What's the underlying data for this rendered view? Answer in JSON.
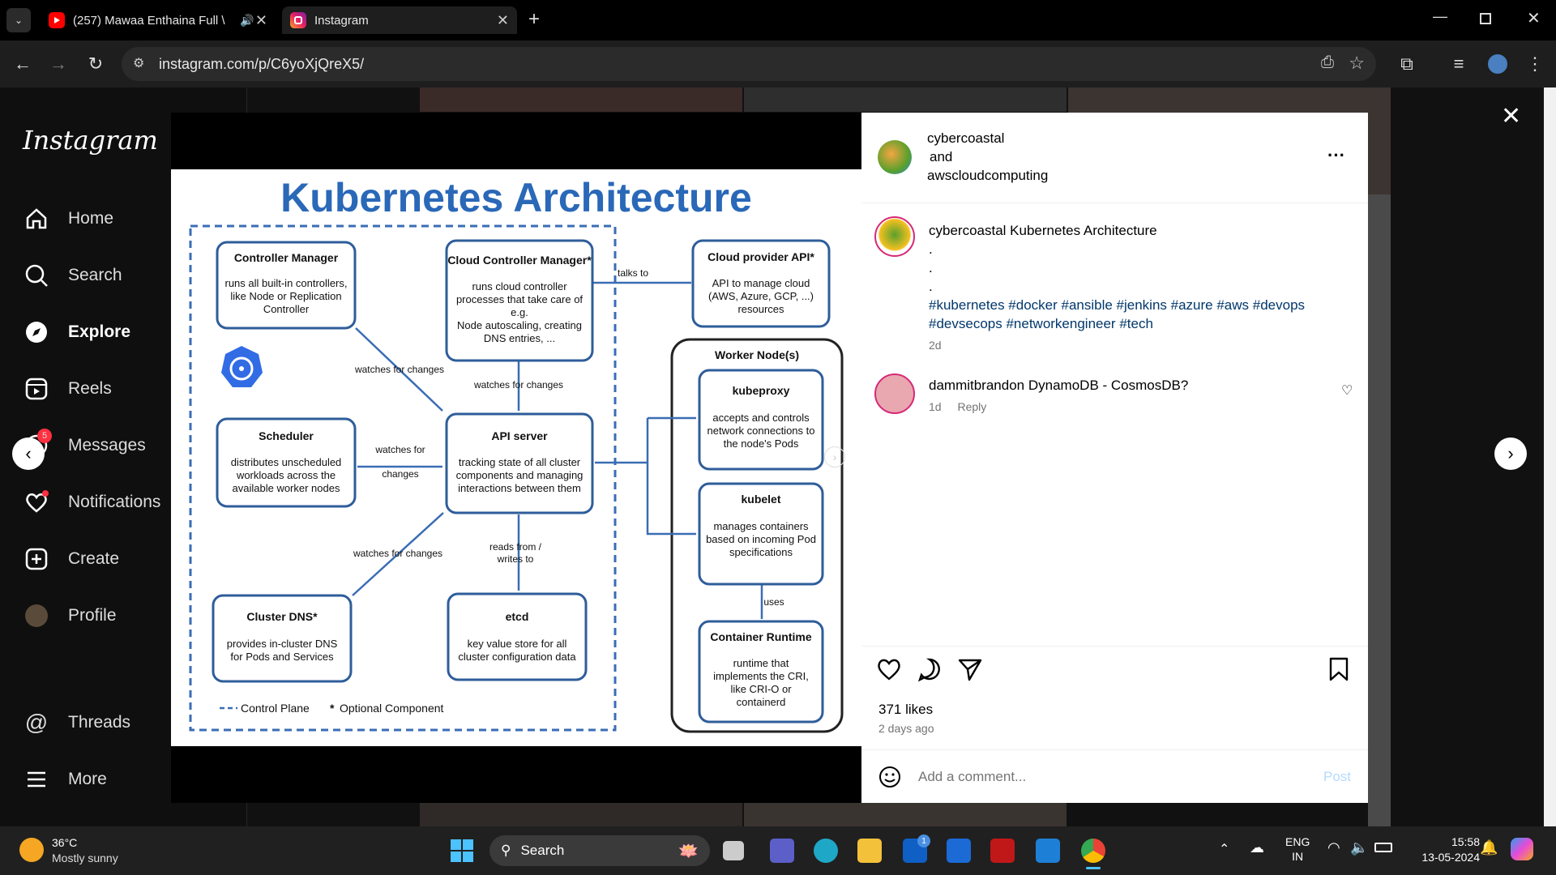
{
  "browser": {
    "tabs": [
      {
        "label": "(257) Mawaa Enthaina Full \\"
      },
      {
        "label": "Instagram"
      }
    ],
    "url": "instagram.com/p/C6yoXjQreX5/"
  },
  "sidebar": {
    "logo": "Instagram",
    "items": [
      {
        "label": "Home",
        "icon": "home-icon"
      },
      {
        "label": "Search",
        "icon": "search-icon"
      },
      {
        "label": "Explore",
        "icon": "compass-icon"
      },
      {
        "label": "Reels",
        "icon": "reels-icon"
      },
      {
        "label": "Messages",
        "icon": "messenger-icon",
        "badge": "5"
      },
      {
        "label": "Notifications",
        "icon": "heart-icon"
      },
      {
        "label": "Create",
        "icon": "plus-square-icon"
      },
      {
        "label": "Profile",
        "icon": "avatar-icon"
      },
      {
        "label": "Threads",
        "icon": "threads-icon"
      },
      {
        "label": "More",
        "icon": "menu-icon"
      }
    ]
  },
  "diagram": {
    "title": "Kubernetes Architecture",
    "controller_manager": {
      "title": "Controller Manager",
      "l1": "runs all built-in controllers,",
      "l2": "like Node or Replication",
      "l3": "Controller"
    },
    "cloud_controller": {
      "title": "Cloud Controller Manager*",
      "l1": "runs cloud controller",
      "l2": "processes that take care of",
      "l3": "e.g.",
      "l4": "Node autoscaling, creating",
      "l5": "DNS entries, ..."
    },
    "cloud_api": {
      "title": "Cloud provider API*",
      "l1": "API to manage cloud",
      "l2": "(AWS, Azure, GCP, ...)",
      "l3": "resources"
    },
    "scheduler": {
      "title": "Scheduler",
      "l1": "distributes unscheduled",
      "l2": "workloads across the",
      "l3": "available worker nodes"
    },
    "api_server": {
      "title": "API server",
      "l1": "tracking state of all cluster",
      "l2": "components and managing",
      "l3": "interactions between them"
    },
    "cluster_dns": {
      "title": "Cluster DNS*",
      "l1": "provides in-cluster DNS",
      "l2": "for Pods and Services"
    },
    "etcd": {
      "title": "etcd",
      "l1": "key value store for all",
      "l2": "cluster configuration data"
    },
    "worker": {
      "title": "Worker Node(s)"
    },
    "kubeproxy": {
      "title": "kubeproxy",
      "l1": "accepts and controls",
      "l2": "network connections to",
      "l3": "the node's Pods"
    },
    "kubelet": {
      "title": "kubelet",
      "l1": "manages containers",
      "l2": "based on incoming Pod",
      "l3": "specifications"
    },
    "runtime": {
      "title": "Container Runtime",
      "l1": "runtime that",
      "l2": "implements the CRI,",
      "l3": "like CRI-O or",
      "l4": "containerd"
    },
    "labels": {
      "talks_to": "talks to",
      "watches1": "watches for changes",
      "watches2": "watches for changes",
      "watches_for": "watches for",
      "changes": "changes",
      "watches3": "watches for changes",
      "reads": "reads from /",
      "writes": "writes to",
      "uses": "uses"
    },
    "legend": {
      "control_plane": "Control Plane",
      "optional": "Optional Component"
    }
  },
  "post": {
    "header_user": "cybercoastal",
    "header_and": "and",
    "header_collab": "awscloudcomputing",
    "caption_user": "cybercoastal",
    "caption_text": "Kubernetes Architecture",
    "dot": ".",
    "hashtags1": "#kubernetes #docker #ansible #jenkins #azure #aws #devops",
    "hashtags2": "#devsecops #networkengineer #tech",
    "caption_time": "2d",
    "comment_user": "dammitbrandon",
    "comment_text": "DynamoDB - CosmosDB?",
    "comment_time": "1d",
    "reply": "Reply",
    "likes": "371 likes",
    "posted": "2 days ago",
    "comment_placeholder": "Add a comment...",
    "post_button": "Post"
  },
  "taskbar": {
    "weather_temp": "36°C",
    "weather_desc": "Mostly sunny",
    "search": "Search",
    "lang1": "ENG",
    "lang2": "IN",
    "time": "15:58",
    "date": "13-05-2024",
    "notify_badge": "1"
  }
}
